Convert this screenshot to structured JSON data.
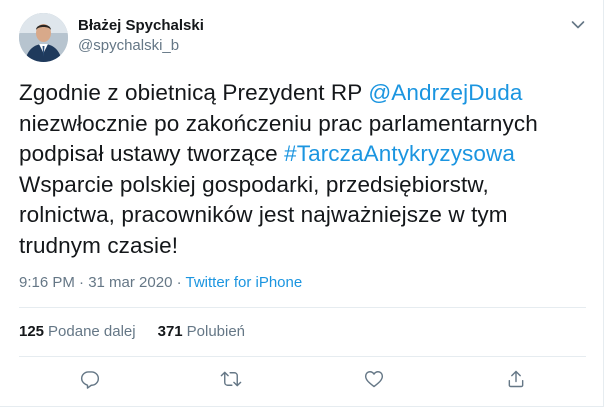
{
  "author": {
    "display_name": "Błażej Spychalski",
    "handle": "@spychalski_b"
  },
  "tweet": {
    "segments": [
      {
        "type": "text",
        "value": "Zgodnie z obietnicą Prezydent RP "
      },
      {
        "type": "mention",
        "value": "@AndrzejDuda"
      },
      {
        "type": "text",
        "value": " niezwłocznie po zakończeniu prac parlamentarnych podpisał ustawy tworzące "
      },
      {
        "type": "hashtag",
        "value": "#TarczaAntykryzysowa"
      },
      {
        "type": "text",
        "value": " Wsparcie polskiej gospodarki, przedsiębiorstw, rolnictwa, pracowników jest najważniejsze w tym trudnym czasie!"
      }
    ],
    "time": "9:16 PM · 31 mar 2020 · ",
    "source": "Twitter for iPhone"
  },
  "stats": {
    "retweets_count": "125",
    "retweets_label": "Podane dalej",
    "likes_count": "371",
    "likes_label": "Polubień"
  },
  "icons": {
    "caret": "chevron-down-icon",
    "reply": "reply-icon",
    "retweet": "retweet-icon",
    "like": "heart-icon",
    "share": "share-icon"
  },
  "colors": {
    "link": "#1b95e0",
    "muted": "#657786",
    "text": "#14171a",
    "border": "#e6ecf0"
  }
}
